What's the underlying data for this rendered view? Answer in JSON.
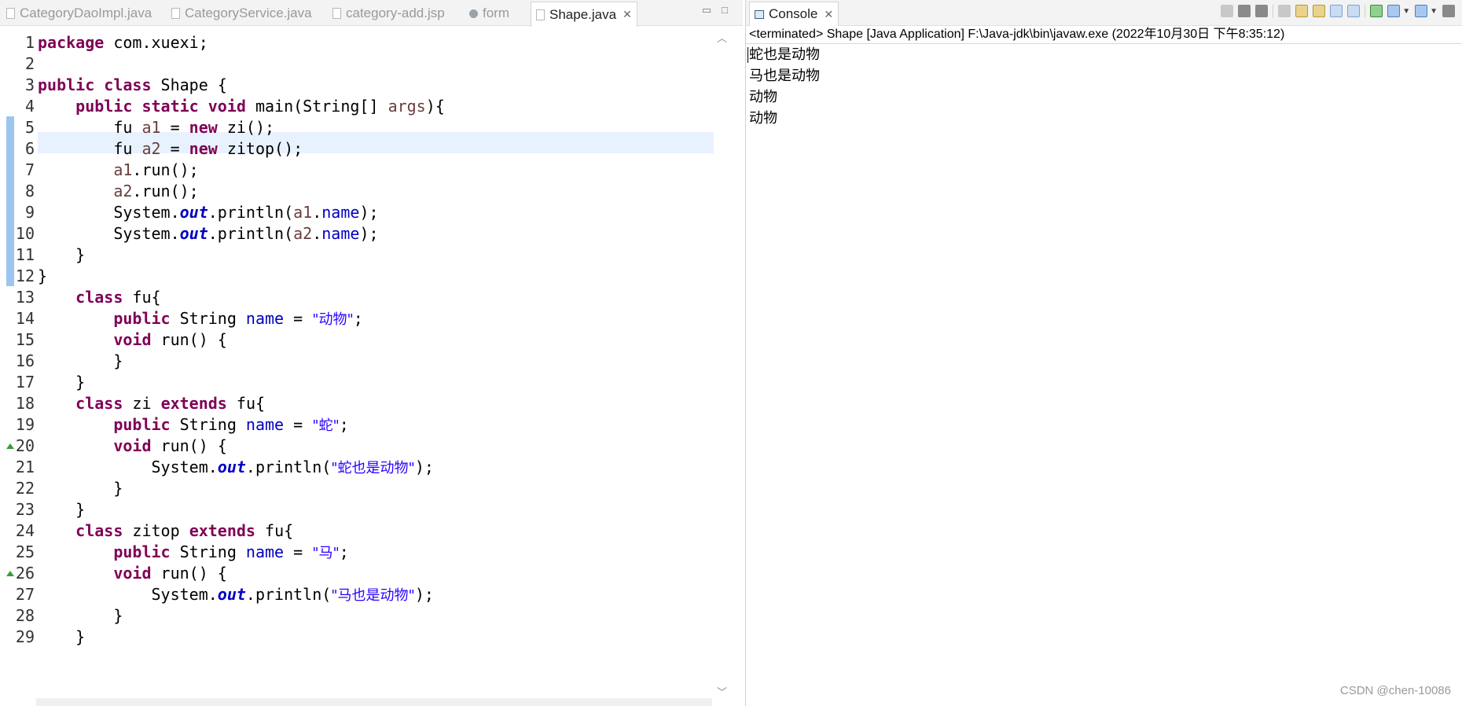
{
  "editor": {
    "tabs": [
      {
        "label": "CategoryDaoImpl.java",
        "icon": "java-file-icon",
        "active": false
      },
      {
        "label": "CategoryService.java",
        "icon": "java-file-icon",
        "active": false
      },
      {
        "label": "category-add.jsp",
        "icon": "jsp-file-icon",
        "active": false
      },
      {
        "label": "form",
        "icon": "globe-icon",
        "active": false
      },
      {
        "label": "Shape.java",
        "icon": "java-file-icon",
        "active": true
      }
    ],
    "tab_close": "✕",
    "minimize": "▭",
    "maximize": "□",
    "lines": [
      {
        "n": "1",
        "html": "<span class='kw'>package</span> com.xuexi;"
      },
      {
        "n": "2",
        "html": ""
      },
      {
        "n": "3",
        "html": "<span class='kw'>public</span> <span class='kw'>class</span> Shape {"
      },
      {
        "n": "4",
        "html": "    <span class='kw'>public</span> <span class='kw'>static</span> <span class='kw'>void</span> main(String[] <span class='loc'>args</span>){"
      },
      {
        "n": "5",
        "html": "        fu <span class='loc'>a1</span> = <span class='kw'>new</span> zi();"
      },
      {
        "n": "6",
        "html": "        fu <span class='loc'>a2</span> = <span class='kw'>new</span> zitop();"
      },
      {
        "n": "7",
        "html": "        <span class='loc'>a1</span>.run();"
      },
      {
        "n": "8",
        "html": "        <span class='loc'>a2</span>.run();"
      },
      {
        "n": "9",
        "html": "        System.<span class='sfld'>out</span>.println(<span class='loc'>a1</span>.<span class='fld'>name</span>);"
      },
      {
        "n": "10",
        "html": "        System.<span class='sfld'>out</span>.println(<span class='loc'>a2</span>.<span class='fld'>name</span>);"
      },
      {
        "n": "11",
        "html": "    }"
      },
      {
        "n": "12",
        "html": "}"
      },
      {
        "n": "13",
        "html": "    <span class='kw'>class</span> fu{"
      },
      {
        "n": "14",
        "html": "        <span class='kw'>public</span> String <span class='fld'>name</span> = <span class='str'>\"动物\"</span>;"
      },
      {
        "n": "15",
        "html": "        <span class='kw'>void</span> run() {"
      },
      {
        "n": "16",
        "html": "        }"
      },
      {
        "n": "17",
        "html": "    }"
      },
      {
        "n": "18",
        "html": "    <span class='kw'>class</span> zi <span class='kw'>extends</span> fu{"
      },
      {
        "n": "19",
        "html": "        <span class='kw'>public</span> String <span class='fld'>name</span> = <span class='str'>\"蛇\"</span>;"
      },
      {
        "n": "20",
        "html": "        <span class='kw'>void</span> run() {"
      },
      {
        "n": "21",
        "html": "            System.<span class='sfld'>out</span>.println(<span class='str'>\"蛇也是动物\"</span>);"
      },
      {
        "n": "22",
        "html": "        }"
      },
      {
        "n": "23",
        "html": "    }"
      },
      {
        "n": "24",
        "html": "    <span class='kw'>class</span> zitop <span class='kw'>extends</span> fu{"
      },
      {
        "n": "25",
        "html": "        <span class='kw'>public</span> String <span class='fld'>name</span> = <span class='str'>\"马\"</span>;"
      },
      {
        "n": "26",
        "html": "        <span class='kw'>void</span> run() {"
      },
      {
        "n": "27",
        "html": "            System.<span class='sfld'>out</span>.println(<span class='str'>\"马也是动物\"</span>);"
      },
      {
        "n": "28",
        "html": "        }"
      },
      {
        "n": "29",
        "html": "    }"
      }
    ],
    "override_marker_lines": [
      "20",
      "26"
    ],
    "colors": {
      "keyword": "#7f0055",
      "string": "#2a00ff",
      "field": "#0000c0",
      "local": "#6a3e3e",
      "current_line": "#e8f2fe"
    }
  },
  "console": {
    "tab_label": "Console",
    "tab_close": "✕",
    "header": "<terminated> Shape [Java Application] F:\\Java-jdk\\bin\\javaw.exe (2022年10月30日 下午8:35:12)",
    "output": [
      "蛇也是动物",
      "马也是动物",
      "动物",
      "动物"
    ],
    "toolbar_icons": [
      "terminate-icon",
      "remove-launch-icon",
      "remove-all-icon",
      "clear-console-icon",
      "scroll-lock-icon",
      "word-wrap-icon",
      "show-on-stdout-icon",
      "show-on-stderr-icon",
      "pin-console-icon",
      "display-selected-console-icon",
      "open-console-icon",
      "view-menu-icon"
    ]
  },
  "watermark": "CSDN @chen-10086"
}
